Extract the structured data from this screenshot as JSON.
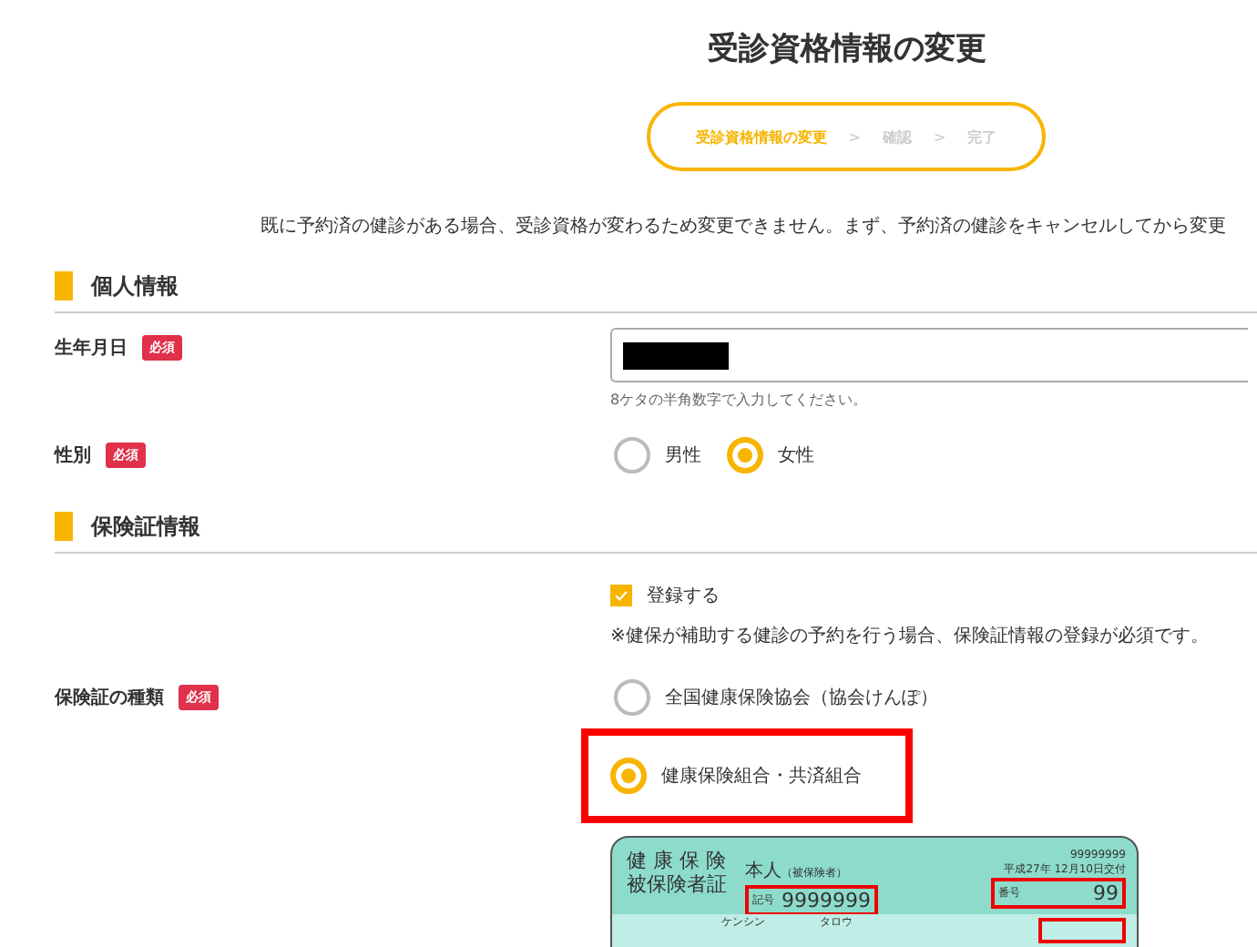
{
  "title": "受診資格情報の変更",
  "stepper": [
    {
      "kind": "step",
      "label": "受診資格情報の変更",
      "selected": true
    },
    {
      "kind": "separator",
      "label": ">"
    },
    {
      "kind": "step",
      "label": "確認",
      "selected": false
    },
    {
      "kind": "separator",
      "label": ">"
    },
    {
      "kind": "step",
      "label": "完了",
      "selected": false
    }
  ],
  "notice": "既に予約済の健診がある場合、受診資格が変わるため変更できません。まず、予約済の健診をキャンセルしてから変更",
  "sections": [
    {
      "heading": "個人情報",
      "fields": [
        {
          "kind": "input",
          "label": "生年月日",
          "required_badge": "必須",
          "value_redacted": true,
          "hint": "8ケタの半角数字で入力してください。"
        },
        {
          "kind": "radio_inline",
          "label": "性別",
          "required_badge": "必須",
          "options": [
            {
              "label": "男性",
              "selected": false
            },
            {
              "label": "女性",
              "selected": true
            }
          ]
        }
      ]
    },
    {
      "heading": "保険証情報",
      "fields": [
        {
          "kind": "checkbox",
          "label_text": "登録する",
          "checked": true,
          "note": "※健保が補助する健診の予約を行う場合、保険証情報の登録が必須です。"
        },
        {
          "kind": "radio_stack",
          "label": "保険証の種類",
          "required_badge": "必須",
          "options": [
            {
              "label": "全国健康保険協会（協会けんぽ）",
              "selected": false,
              "highlighted": false
            },
            {
              "label": "健康保険組合・共済組合",
              "selected": true,
              "highlighted": true
            }
          ]
        },
        {
          "kind": "card",
          "card": {
            "title_line_1": "健 康 保 険",
            "title_line_2": "被保険者証",
            "person": "本人",
            "person_note": "（被保険者）",
            "insurer_number": "99999999",
            "issue_date": "平成27年 12月10日交付",
            "symbol_label": "記号",
            "symbol_value": "9999999",
            "number_label": "番号",
            "number_value": "99",
            "kana_family": "ケンシン",
            "kana_given": "タロウ"
          }
        }
      ]
    }
  ]
}
